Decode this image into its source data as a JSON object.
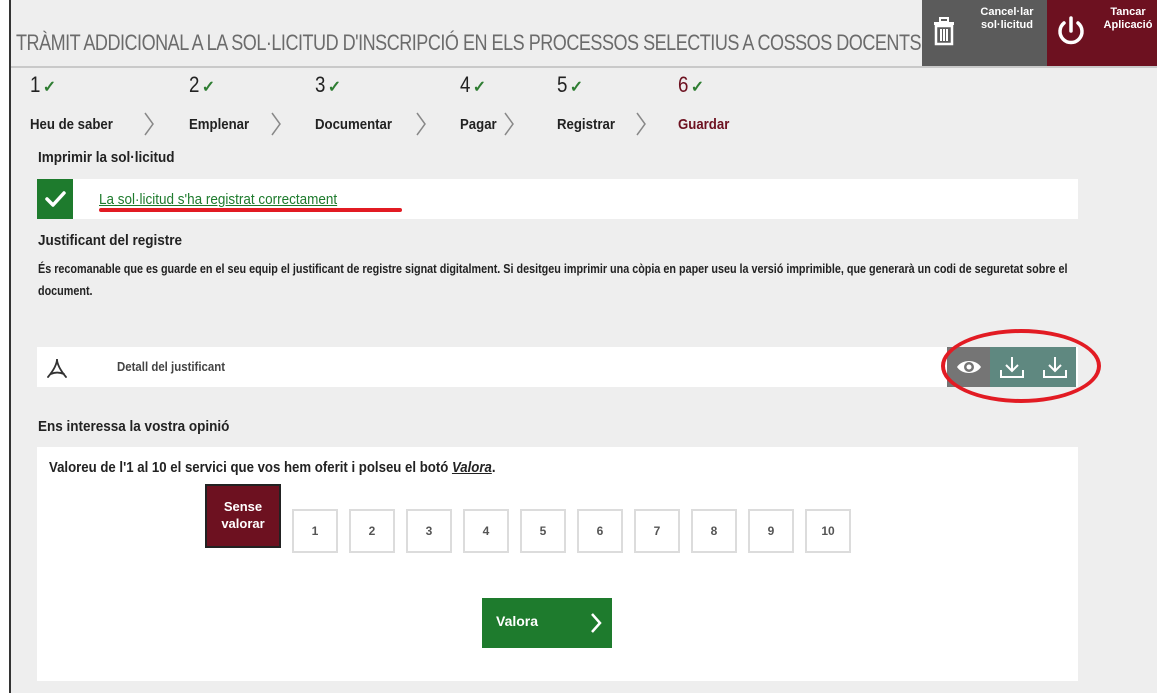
{
  "header": {
    "title": "TRÀMIT ADDICIONAL A LA SOL·LICITUD D'INSCRIPCIÓ EN ELS PROCESSOS SELECTIUS A COSSOS DOCENTS",
    "cancel_label": "Cancel·lar\nsol·licitud",
    "close_label": "Tancar\nAplicació",
    "colors": {
      "cancel_bg": "#5b5b5b",
      "close_bg": "#6d1120"
    }
  },
  "steps": [
    {
      "number": "1",
      "check": "✓",
      "label": "Heu de saber"
    },
    {
      "number": "2",
      "check": "✓",
      "label": "Emplenar"
    },
    {
      "number": "3",
      "check": "✓",
      "label": "Documentar"
    },
    {
      "number": "4",
      "check": "✓",
      "label": "Pagar"
    },
    {
      "number": "5",
      "check": "✓",
      "label": "Registrar"
    },
    {
      "number": "6",
      "check": "✓",
      "label": "Guardar",
      "active": true
    }
  ],
  "print_heading": "Imprimir la sol·licitud",
  "success_message": "La sol·licitud s'ha registrat correctament",
  "receipt": {
    "heading": "Justificant del registre",
    "description": "És recomanable que es guarde en el seu equip el justificant de registre signat digitalment. Si desitgeu imprimir una còpia en paper useu la versió imprimible, que generarà un codi de seguretat sobre el document.",
    "detail_label": "Detall del justificant",
    "actions": [
      "eye-icon",
      "download-icon",
      "download-icon"
    ]
  },
  "opinion": {
    "heading": "Ens interessa la vostra opinió",
    "instructions_prefix": "Valoreu de l'1 al 10 el servici que vos hem oferit i polseu el botó ",
    "instructions_link": "Valora",
    "instructions_suffix": ".",
    "no_rating_label": "Sense\nvalorar",
    "scale": [
      "1",
      "2",
      "3",
      "4",
      "5",
      "6",
      "7",
      "8",
      "9",
      "10"
    ],
    "submit_label": "Valora"
  },
  "colors": {
    "accent_green": "#1e7b2d",
    "accent_maroon": "#6d1120",
    "highlight_red": "#e21b23"
  }
}
